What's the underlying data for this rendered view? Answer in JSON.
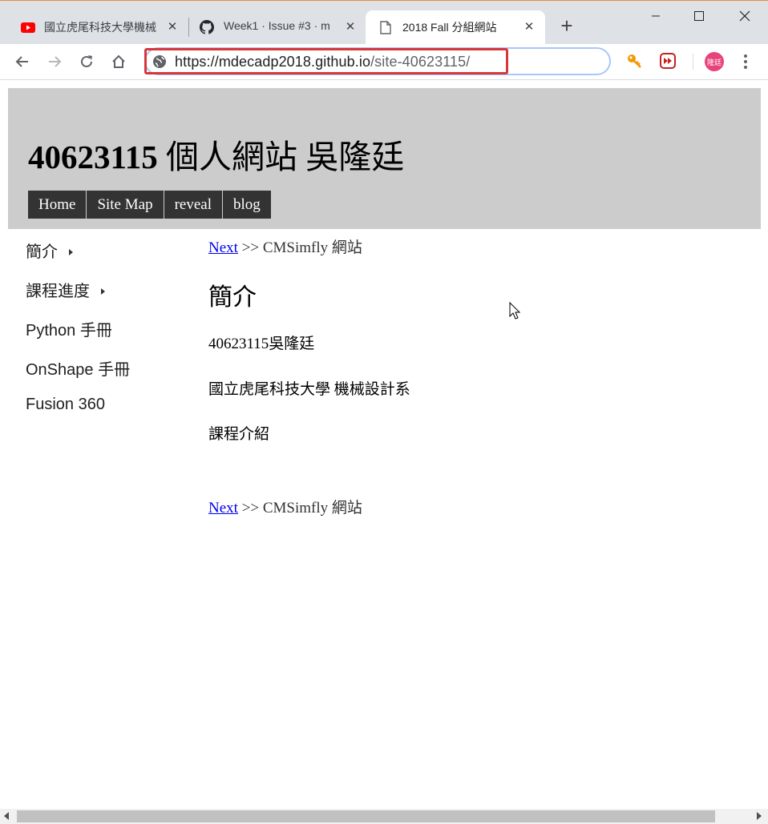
{
  "browser": {
    "tabs": [
      {
        "title": "國立虎尾科技大學機械",
        "favicon": "youtube-icon",
        "active": false
      },
      {
        "title": "Week1 · Issue #3 · m",
        "favicon": "github-icon",
        "active": false
      },
      {
        "title": "2018 Fall 分組網站",
        "favicon": "page-icon",
        "active": true
      }
    ],
    "new_tab_label": "+",
    "url_host": "https://mdecadp2018.github.io",
    "url_path": "/site-40623115/",
    "avatar_text": "隆廷"
  },
  "site": {
    "title_number": "40623115",
    "title_rest": " 個人網站 吳隆廷",
    "nav": [
      "Home",
      "Site Map",
      "reveal",
      "blog"
    ]
  },
  "sidebar": {
    "items": [
      {
        "label": "簡介",
        "has_submenu": true
      },
      {
        "label": "課程進度",
        "has_submenu": true
      },
      {
        "label": "Python 手冊",
        "has_submenu": false
      },
      {
        "label": "OnShape 手冊",
        "has_submenu": false
      },
      {
        "label": "Fusion 360",
        "has_submenu": false
      }
    ]
  },
  "content": {
    "next_link": "Next",
    "next_suffix": " >> CMSimfly 網站",
    "heading": "簡介",
    "paragraphs": [
      "40623115吳隆廷",
      "國立虎尾科技大學 機械設計系",
      "課程介紹"
    ]
  },
  "colors": {
    "header_bg": "#cccccc",
    "nav_bg": "#333333",
    "link": "#0000ee",
    "url_highlight": "#d6373a",
    "avatar_bg": "#e8437a"
  }
}
